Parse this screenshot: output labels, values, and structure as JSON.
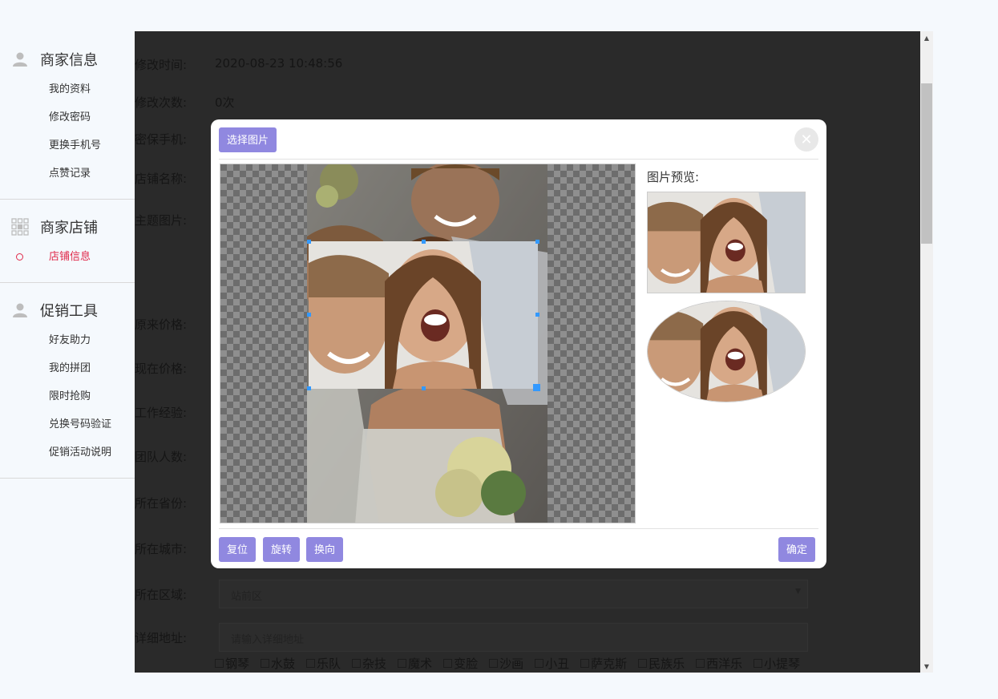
{
  "sidebar": {
    "sections": [
      {
        "title": "商家信息",
        "icon": "user-icon",
        "items": [
          "我的资料",
          "修改密码",
          "更换手机号",
          "点赞记录"
        ]
      },
      {
        "title": "商家店铺",
        "icon": "grid-icon",
        "items": [
          "店铺信息"
        ]
      },
      {
        "title": "促销工具",
        "icon": "user-icon",
        "items": [
          "好友助力",
          "我的拼团",
          "限时抢购",
          "兑换号码验证",
          "促销活动说明"
        ]
      }
    ],
    "active_item": "店铺信息"
  },
  "form": {
    "modify_time_label": "修改时间:",
    "modify_time_value": "2020-08-23 10:48:56",
    "modify_count_label": "修改次数:",
    "modify_count_value": "0次",
    "security_phone_label": "密保手机:",
    "shop_name_label": "店铺名称:",
    "theme_image_label": "主题图片:",
    "original_price_label": "原来价格:",
    "current_price_label": "现在价格:",
    "work_experience_label": "工作经验:",
    "team_size_label": "团队人数:",
    "province_label": "所在省份:",
    "city_label": "所在城市:",
    "district_label": "所在区域:",
    "district_value": "站前区",
    "address_label": "详细地址:",
    "address_placeholder": "请输入详细地址",
    "skills": [
      "钢琴",
      "水鼓",
      "乐队",
      "杂技",
      "魔术",
      "变脸",
      "沙画",
      "小丑",
      "萨克斯",
      "民族乐",
      "西洋乐",
      "小提琴"
    ]
  },
  "modal": {
    "select_image_label": "选择图片",
    "preview_label": "图片预览:",
    "reset_label": "复位",
    "rotate_label": "旋转",
    "flip_label": "换向",
    "confirm_label": "确定",
    "close_icon": "close-icon"
  },
  "colors": {
    "button": "#9088e0",
    "crop_border": "#3399ff",
    "active_menu": "#e0294a"
  }
}
